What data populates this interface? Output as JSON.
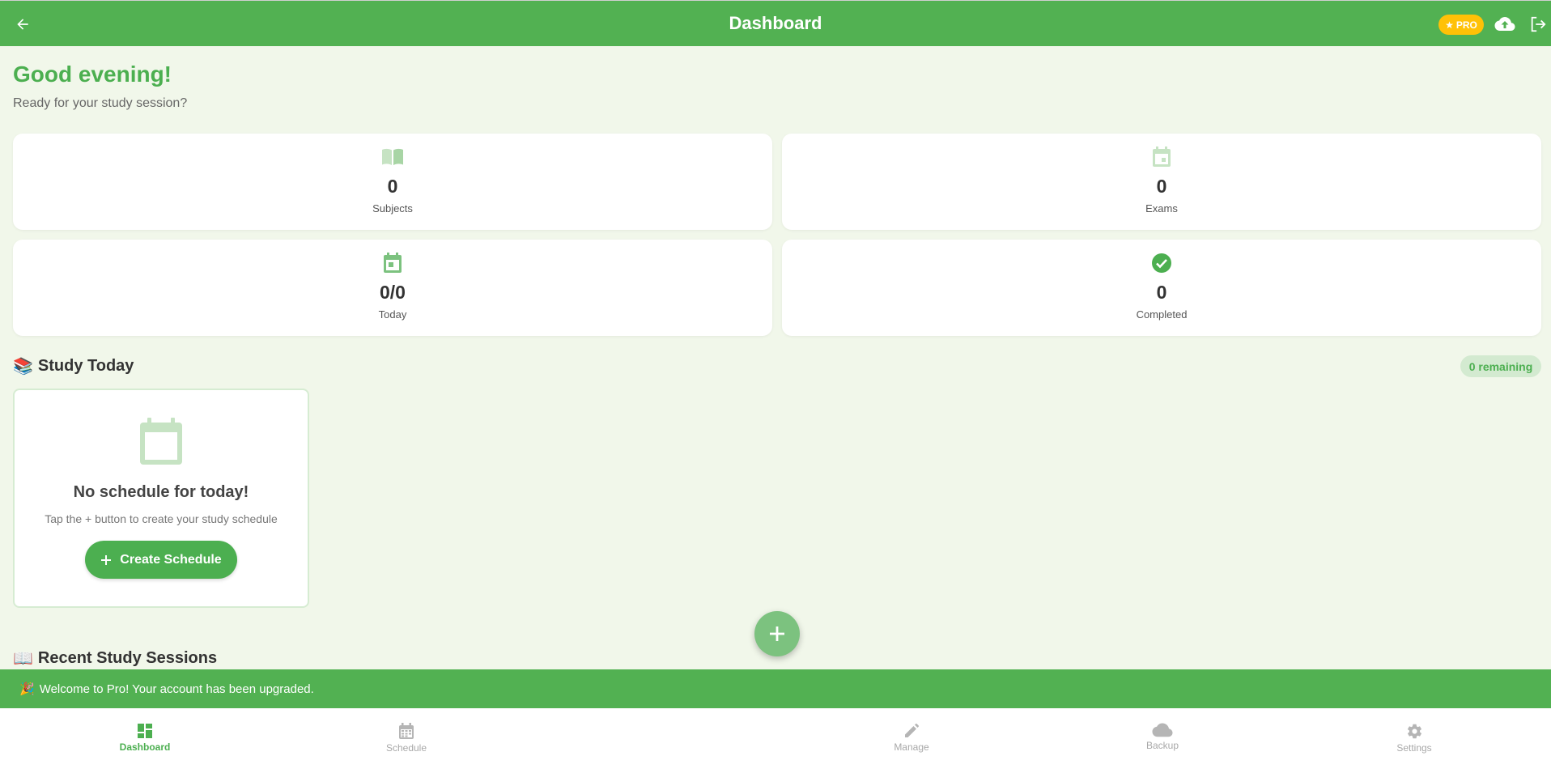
{
  "header": {
    "title": "Dashboard",
    "pro_badge": "PRO",
    "back_icon": "arrow-left-icon",
    "upload_icon": "cloud-upload-icon",
    "logout_icon": "logout-icon"
  },
  "greeting": {
    "title": "Good evening!",
    "subtitle": "Ready for your study session?"
  },
  "stats": [
    {
      "icon": "book-icon",
      "value": "0",
      "label": "Subjects"
    },
    {
      "icon": "calendar-icon",
      "value": "0",
      "label": "Exams"
    },
    {
      "icon": "calendar-today-icon",
      "value": "0/0",
      "label": "Today"
    },
    {
      "icon": "check-circle-icon",
      "value": "0",
      "label": "Completed"
    }
  ],
  "study_today": {
    "emoji": "📚",
    "title": "Study Today",
    "remaining": "0 remaining",
    "empty_title": "No schedule for today!",
    "empty_hint": "Tap the + button to create your study schedule",
    "create_button": "Create Schedule"
  },
  "recent": {
    "emoji": "📖",
    "title": "Recent Study Sessions"
  },
  "snackbar": {
    "emoji": "🎉",
    "text": "Welcome to Pro! Your account has been upgraded."
  },
  "nav": [
    {
      "icon": "dashboard-icon",
      "label": "Dashboard",
      "active": true
    },
    {
      "icon": "schedule-icon",
      "label": "Schedule",
      "active": false
    },
    {
      "icon": "pencil-icon",
      "label": "Manage",
      "active": false
    },
    {
      "icon": "cloud-icon",
      "label": "Backup",
      "active": false
    },
    {
      "icon": "gear-icon",
      "label": "Settings",
      "active": false
    }
  ],
  "colors": {
    "primary": "#4caf50",
    "header": "#52b152",
    "background": "#f1f7ea",
    "pro": "#ffc107"
  }
}
